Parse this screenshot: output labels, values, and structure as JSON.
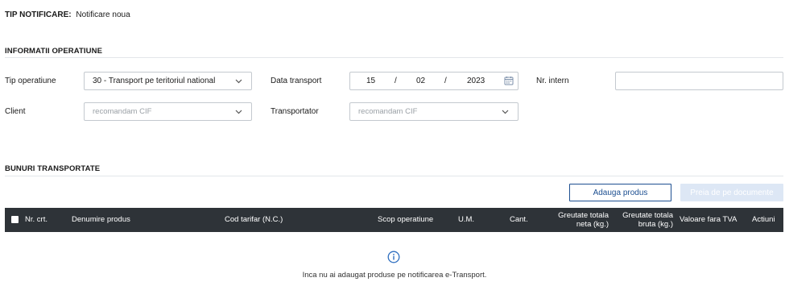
{
  "notification": {
    "type_label": "TIP NOTIFICARE:",
    "type_value": "Notificare noua"
  },
  "operation_info": {
    "title": "INFORMATII OPERATIUNE",
    "operation_type": {
      "label": "Tip operatiune",
      "value": "30 - Transport pe teritoriul national"
    },
    "transport_date": {
      "label": "Data transport",
      "day": "15",
      "month": "02",
      "year": "2023",
      "separator": "/"
    },
    "internal_nr": {
      "label": "Nr. intern",
      "value": ""
    },
    "client": {
      "label": "Client",
      "placeholder": "recomandam CIF"
    },
    "transporter": {
      "label": "Transportator",
      "placeholder": "recomandam CIF"
    }
  },
  "goods": {
    "title": "BUNURI TRANSPORTATE",
    "add_product_label": "Adauga produs",
    "import_from_documents_label": "Preia de pe documente",
    "columns": {
      "nr_crt": "Nr. crt.",
      "product_name": "Denumire produs",
      "tariff_code": "Cod tarifar (N.C.)",
      "operation_scope": "Scop operatiune",
      "unit": "U.M.",
      "quantity": "Cant.",
      "net_weight_1": "Greutate totala",
      "net_weight_2": "neta (kg.)",
      "gross_weight_1": "Greutate totala",
      "gross_weight_2": "bruta (kg.)",
      "value_no_vat": "Valoare fara TVA",
      "actions": "Actiuni"
    },
    "rows": [],
    "empty_message": "Inca nu ai adaugat produse pe notificarea e-Transport."
  },
  "colors": {
    "accent": "#1d4f91",
    "table_header": "#2e3338",
    "disabled_button": "#dde7f5",
    "info_icon": "#2f6fc0"
  },
  "icons": {
    "dropdown": "chevron-down-icon",
    "calendar": "calendar-icon",
    "info": "info-icon"
  }
}
